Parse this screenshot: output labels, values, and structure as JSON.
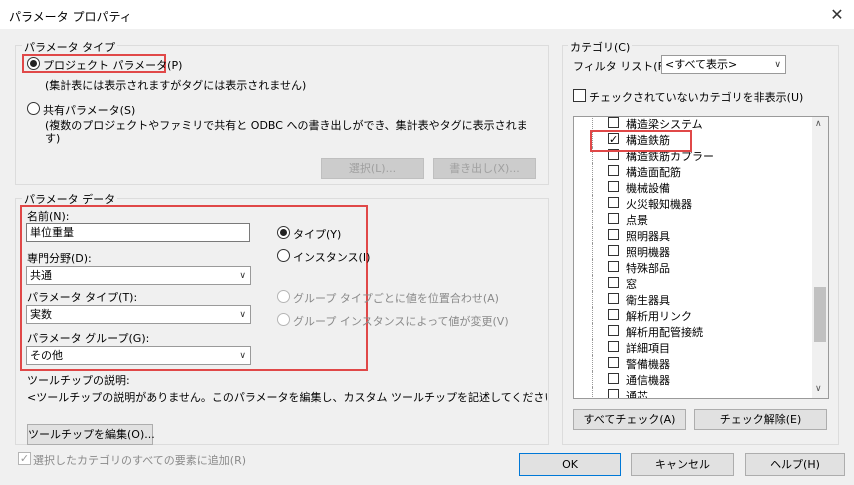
{
  "window": {
    "title": "パラメータ プロパティ",
    "close": "✕"
  },
  "param_type": {
    "group_label": "パラメータ タイプ",
    "project_label": "プロジェクト パラメータ(P)",
    "project_note": "(集計表には表示されますがタグには表示されません)",
    "shared_label": "共有パラメータ(S)",
    "shared_note_1": "(複数のプロジェクトやファミリで共有と ODBC への書き出しができ、集計表やタグに表示されま",
    "shared_note_2": "す)",
    "select_button": "選択(L)...",
    "export_button": "書き出し(X)..."
  },
  "param_data": {
    "group_label": "パラメータ データ",
    "name_label": "名前(N):",
    "name_value": "単位重量",
    "discipline_label": "専門分野(D):",
    "discipline_value": "共通",
    "type_label": "パラメータ タイプ(T):",
    "type_value": "実数",
    "group_param_label": "パラメータ グループ(G):",
    "group_param_value": "その他",
    "radio_type": "タイプ(Y)",
    "radio_instance": "インスタンス(I)",
    "align_group": "グループ タイプごとに値を位置合わせ(A)",
    "vary_group": "グループ インスタンスによって値が変更(V)"
  },
  "tooltip": {
    "label": "ツールチップの説明:",
    "text": "<ツールチップの説明がありません。このパラメータを編集し、カスタム ツールチップを記述してください。カスタム ツ...",
    "edit_button": "ツールチップを編集(O)..."
  },
  "add_all": {
    "label": "選択したカテゴリのすべての要素に追加(R)",
    "checked": true
  },
  "category": {
    "group_label": "カテゴリ(C)",
    "filter_label": "フィルタ リスト(F):",
    "filter_value": "<すべて表示>",
    "hide_unchecked": "チェックされていないカテゴリを非表示(U)",
    "items": [
      {
        "label": "構造梁システム",
        "checked": false
      },
      {
        "label": "構造鉄筋",
        "checked": true
      },
      {
        "label": "構造鉄筋カプラー",
        "checked": false
      },
      {
        "label": "構造面配筋",
        "checked": false
      },
      {
        "label": "機械設備",
        "checked": false
      },
      {
        "label": "火災報知機器",
        "checked": false
      },
      {
        "label": "点景",
        "checked": false
      },
      {
        "label": "照明器具",
        "checked": false
      },
      {
        "label": "照明機器",
        "checked": false
      },
      {
        "label": "特殊部品",
        "checked": false
      },
      {
        "label": "窓",
        "checked": false
      },
      {
        "label": "衛生器具",
        "checked": false
      },
      {
        "label": "解析用リンク",
        "checked": false
      },
      {
        "label": "解析用配管接続",
        "checked": false
      },
      {
        "label": "詳細項目",
        "checked": false
      },
      {
        "label": "警備機器",
        "checked": false
      },
      {
        "label": "通信機器",
        "checked": false
      },
      {
        "label": "通芯",
        "checked": false
      }
    ],
    "check_all": "すべてチェック(A)",
    "uncheck_all": "チェック解除(E)"
  },
  "footer": {
    "ok": "OK",
    "cancel": "キャンセル",
    "help": "ヘルプ(H)"
  }
}
